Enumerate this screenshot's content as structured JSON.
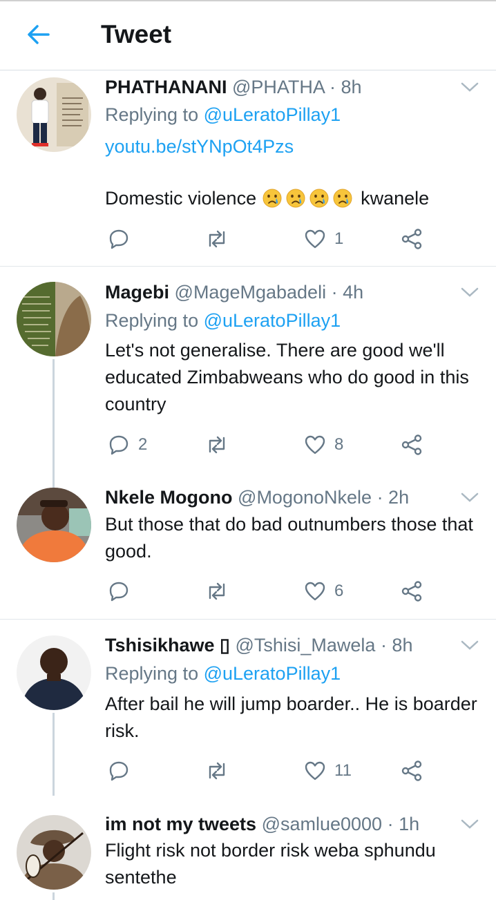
{
  "header": {
    "title": "Tweet"
  },
  "tweets": [
    {
      "name": "PHATHANANI",
      "handle": "@PHATHA",
      "time": "· 8h",
      "replying_prefix": "Replying to ",
      "replying_to": "@uLeratoPillay1",
      "link": "youtu.be/stYNpOt4Pzs",
      "text_before": "Domestic violence ",
      "text_after": " kwanele",
      "emoji": "crying-face",
      "reply_count": "",
      "retweet_count": "",
      "like_count": "1"
    },
    {
      "name": "Magebi",
      "handle": "@MageMgabadeli",
      "time": "· 4h",
      "replying_prefix": "Replying to ",
      "replying_to": "@uLeratoPillay1",
      "text": "Let's not generalise. There are good we'll educated Zimbabweans who do good in this country",
      "reply_count": "2",
      "retweet_count": "",
      "like_count": "8"
    },
    {
      "name": "Nkele Mogono",
      "handle": "@MogonoNkele",
      "time": "· 2h",
      "text": "But those that do bad outnumbers those that good.",
      "reply_count": "",
      "retweet_count": "",
      "like_count": "6"
    },
    {
      "name": "Tshisikhawe ▯",
      "handle": "@Tshisi_Mawela",
      "time": "· 8h",
      "replying_prefix": "Replying to ",
      "replying_to": "@uLeratoPillay1",
      "text": "After bail he will jump boarder.. He is boarder risk.",
      "reply_count": "",
      "retweet_count": "",
      "like_count": "11"
    },
    {
      "name": "im not my tweets",
      "handle": "@samlue0000",
      "time": "· 1h",
      "text": "Flight risk not border risk weba sphundu sentethe"
    }
  ],
  "colors": {
    "accent": "#1da1f2",
    "secondary_text": "#657786",
    "divider": "#e1e6ea"
  },
  "icons": {
    "back": "arrow-left-icon",
    "reply": "reply-icon",
    "retweet": "retweet-icon",
    "like": "heart-icon",
    "share": "share-icon",
    "more": "chevron-down-icon"
  }
}
